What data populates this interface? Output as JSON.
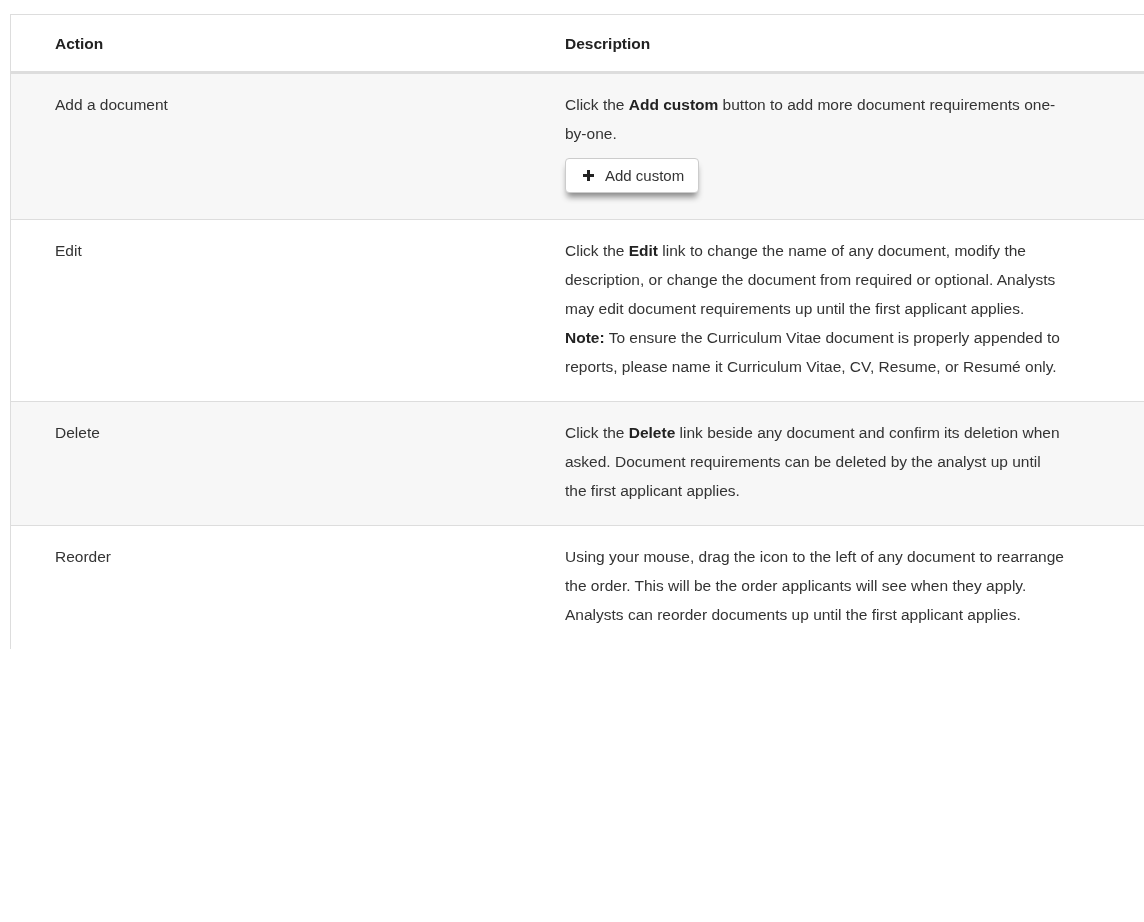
{
  "table": {
    "columns": [
      "Action",
      "Description"
    ],
    "rows": [
      {
        "action": "Add a document",
        "description": "Click the **Add custom** button to add more document requirements one-by-one.",
        "button": {
          "label": "Add custom"
        }
      },
      {
        "action": "Edit",
        "description": "Click the **Edit** link to change the name of any document, modify the description, or change the document from required or optional. Analysts may edit document requirements up until the first applicant applies. **Note:** To ensure the Curriculum Vitae document is properly appended to reports, please name it Curriculum Vitae, CV, Resume, or Resumé only."
      },
      {
        "action": "Delete",
        "description": "Click the **Delete** link beside any document and confirm its deletion when asked. Document requirements can be deleted by the analyst up until the first applicant applies."
      },
      {
        "action": "Reorder",
        "description": "Using your mouse, drag the icon to the left of any document to rearrange the order. This will be the order applicants will see when they apply. Analysts can reorder documents up until the first applicant applies."
      }
    ]
  }
}
